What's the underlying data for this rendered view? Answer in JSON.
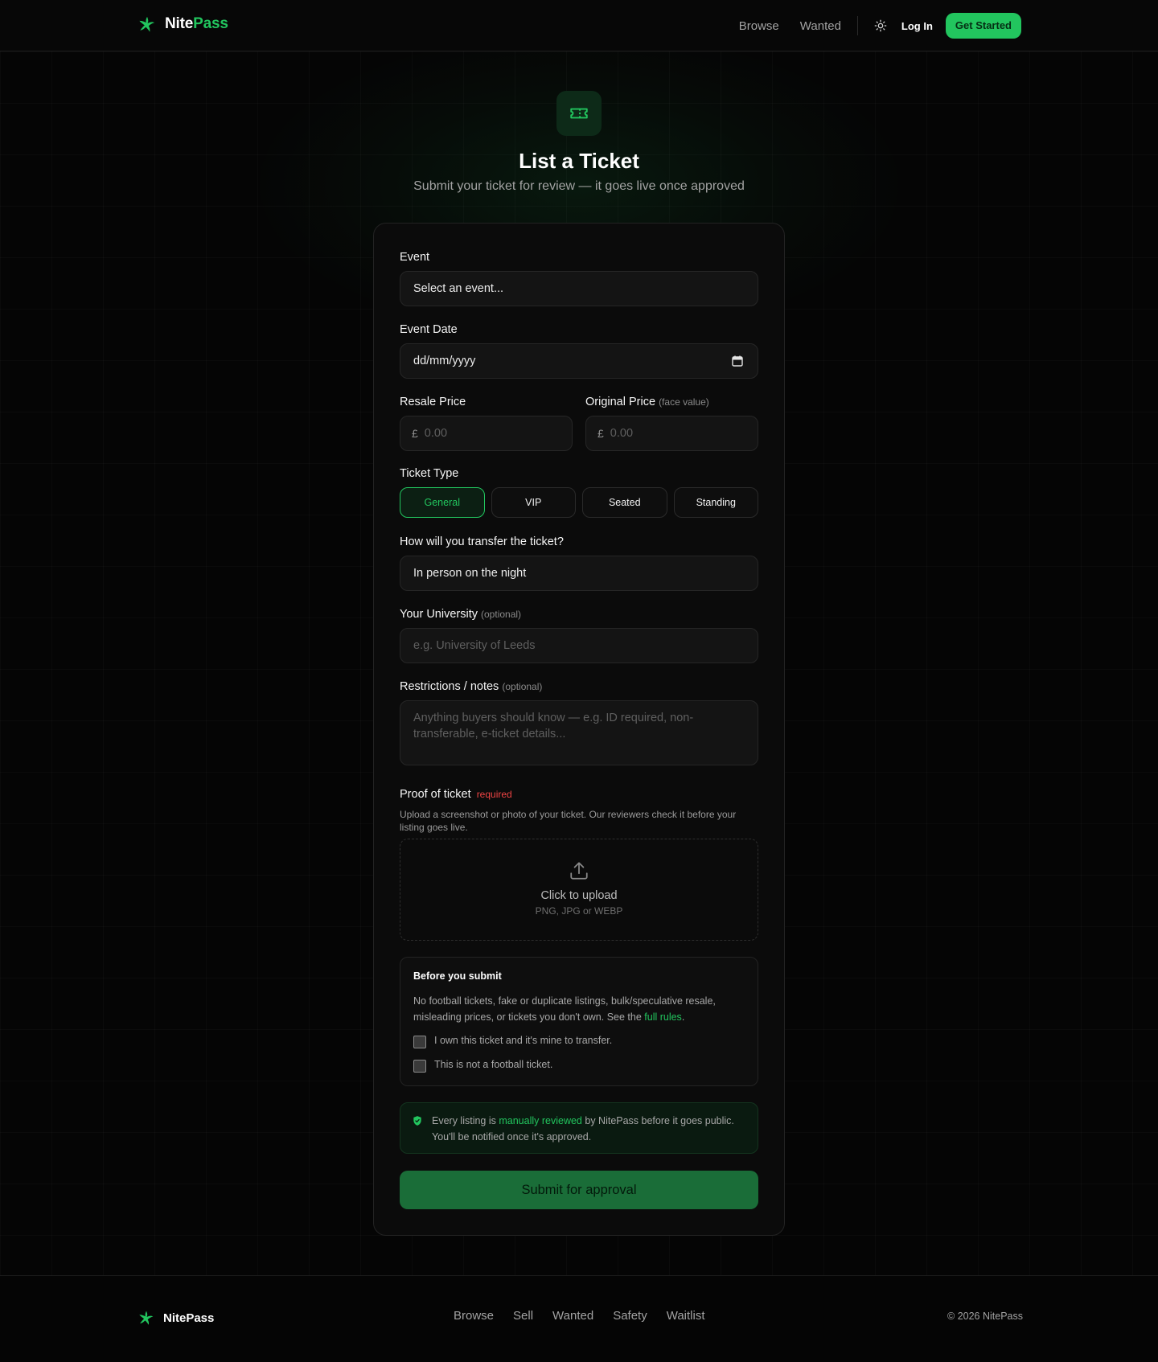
{
  "brand": {
    "name_part1": "Nite",
    "name_part2": "Pass",
    "accent": "#22c55e",
    "logo_icon": "star-leaf-icon"
  },
  "nav": {
    "links": [
      "Browse",
      "Wanted"
    ],
    "theme_icon": "sun-icon",
    "login": "Log In",
    "cta": "Get Started"
  },
  "hero": {
    "icon": "ticket-icon",
    "title": "List a Ticket",
    "subtitle": "Submit your ticket for review — it goes live once approved"
  },
  "form": {
    "event": {
      "label": "Event",
      "value": "Select an event..."
    },
    "event_date": {
      "label": "Event Date",
      "value": "dd/mm/yyyy",
      "icon": "calendar-icon"
    },
    "resale_price": {
      "label": "Resale Price",
      "currency": "£",
      "placeholder": "0.00"
    },
    "original_price": {
      "label": "Original Price",
      "hint": "(face value)",
      "currency": "£",
      "placeholder": "0.00"
    },
    "ticket_type": {
      "label": "Ticket Type",
      "options": [
        "General",
        "VIP",
        "Seated",
        "Standing"
      ],
      "selected": "General"
    },
    "transfer": {
      "label": "How will you transfer the ticket?",
      "value": "In person on the night"
    },
    "university": {
      "label": "Your University",
      "hint": "(optional)",
      "placeholder": "e.g. University of Leeds"
    },
    "notes": {
      "label": "Restrictions / notes",
      "hint": "(optional)",
      "placeholder": "Anything buyers should know — e.g. ID required, non-transferable, e-ticket details..."
    },
    "proof": {
      "label": "Proof of ticket",
      "required": "required",
      "help": "Upload a screenshot or photo of your ticket. Our reviewers check it before your listing goes live.",
      "upload_icon": "upload-icon",
      "upload_title": "Click to upload",
      "upload_formats": "PNG, JPG or WEBP"
    },
    "rules": {
      "title": "Before you submit",
      "text": "No football tickets, fake or duplicate listings, bulk/speculative resale, misleading prices, or tickets you don't own. See the ",
      "link": "full rules",
      "text_end": ".",
      "checks": [
        "I own this ticket and it's mine to transfer.",
        "This is not a football ticket."
      ]
    },
    "notice": {
      "icon": "shield-icon",
      "pre": "Every listing is ",
      "highlight": "manually reviewed",
      "post": " by NitePass before it goes public. You'll be notified once it's approved."
    },
    "submit": "Submit for approval"
  },
  "footer": {
    "name": "NitePass",
    "links": [
      "Browse",
      "Sell",
      "Wanted",
      "Safety",
      "Waitlist"
    ],
    "copyright": "© 2026 NitePass"
  }
}
